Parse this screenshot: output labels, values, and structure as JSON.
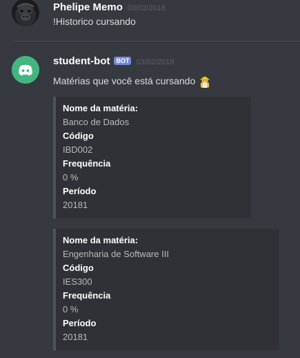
{
  "messages": [
    {
      "username": "Phelipe Memo",
      "timestamp": "03/02/2018",
      "text": "!Historico cursando",
      "avatar_icon": "gorilla-avatar"
    },
    {
      "username": "student-bot",
      "bot_tag": "BOT",
      "timestamp": "03/02/2018",
      "text": "Matérias que você está cursando",
      "emoji_icon": "construction-worker-icon",
      "avatar_icon": "discord-logo-avatar",
      "avatar_color": "#43b581",
      "embeds": [
        {
          "fields": [
            {
              "name": "Nome da matéria:",
              "value": "Banco de Dados"
            },
            {
              "name": "Código",
              "value": "IBD002"
            },
            {
              "name": "Frequência",
              "value": "0 %"
            },
            {
              "name": "Período",
              "value": "20181"
            }
          ]
        },
        {
          "fields": [
            {
              "name": "Nome da matéria:",
              "value": "Engenharia de Software III"
            },
            {
              "name": "Código",
              "value": "IES300"
            },
            {
              "name": "Frequência",
              "value": "0 %"
            },
            {
              "name": "Período",
              "value": "20181"
            }
          ]
        }
      ]
    }
  ],
  "colors": {
    "background": "#36393f",
    "embed_background": "#2f3136",
    "embed_border": "#4f545c",
    "bot_tag": "#7289da",
    "username": "#ffffff",
    "timestamp": "#5d6068"
  }
}
